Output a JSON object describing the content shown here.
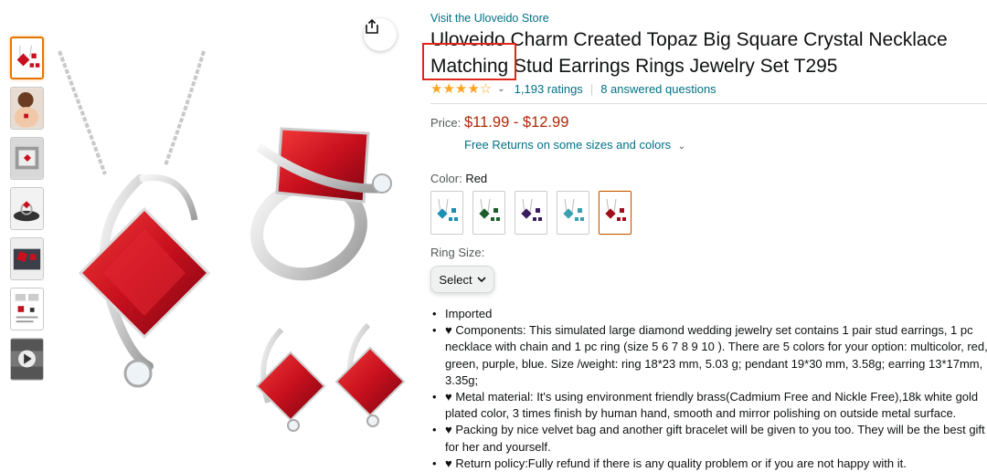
{
  "store_link": "Visit the Uloveido Store",
  "title": {
    "brand": "Uloveido",
    "rest": " Charm Created Topaz Big Square Crystal Necklace Matching Stud Earrings Rings Jewelry Set T295"
  },
  "rating": {
    "stars": "★★★★☆",
    "ratings_count": "1,193 ratings",
    "separator": "|",
    "questions": "8 answered questions"
  },
  "price": {
    "label": "Price:",
    "value": "$11.99 - $12.99",
    "returns": "Free Returns on some sizes and colors"
  },
  "color": {
    "label": "Color:",
    "selected": "Red",
    "swatches": [
      "multicolor",
      "green",
      "purple",
      "blue",
      "red"
    ]
  },
  "ring_size": {
    "label": "Ring Size:",
    "select_label": "Select"
  },
  "bullets": [
    "Imported",
    "♥ Components: This simulated large diamond wedding jewelry set contains 1 pair stud earrings, 1 pc necklace with chain and 1 pc ring (size 5 6 7 8 9 10 ). There are 5 colors for your option: multicolor, red, green, purple, blue. Size /weight: ring 18*23 mm, 5.03 g; pendant 19*30 mm, 3.58g; earring 13*17mm, 3.35g;",
    "♥ Metal material: It's using environment friendly brass(Cadmium Free and Nickle Free),18k white gold plated color, 3 times finish by human hand, smooth and mirror polishing on outside metal surface.",
    "♥ Packing by nice velvet bag and another gift bracelet will be given to you too. They will be the best gift for her and yourself.",
    "♥ Return policy:Fully refund if there is any quality problem or if you are not happy with it."
  ],
  "colors": {
    "link": "#007185",
    "price": "#B12704",
    "star": "#FFA41C",
    "highlight_box": "#E0261B",
    "gem_red": "#C8101E"
  }
}
